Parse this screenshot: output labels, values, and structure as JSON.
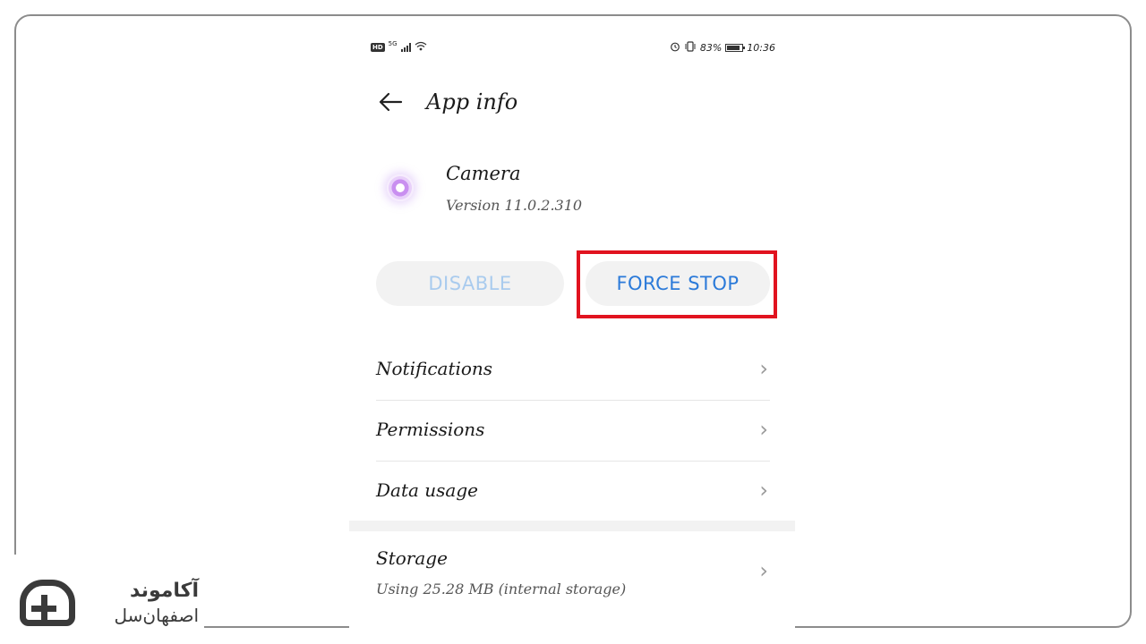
{
  "status_bar": {
    "hd": "HD",
    "network": "5G",
    "battery_text": "83%",
    "battery_level": 0.83,
    "time": "10:36"
  },
  "header": {
    "back_icon": "arrow-left-icon",
    "title": "App info"
  },
  "app": {
    "name": "Camera",
    "version": "Version 11.0.2.310"
  },
  "buttons": {
    "disable": "DISABLE",
    "force_stop": "FORCE STOP"
  },
  "list": [
    {
      "label": "Notifications"
    },
    {
      "label": "Permissions"
    },
    {
      "label": "Data usage"
    }
  ],
  "storage": {
    "label": "Storage",
    "detail": "Using 25.28 MB (internal storage)"
  },
  "watermark": {
    "line1": "آکاموند",
    "line2": "اصفهان‌سل"
  },
  "colors": {
    "accent": "#2b7ad9",
    "disabled_text": "#a9cbee",
    "highlight_border": "#e1131f"
  }
}
